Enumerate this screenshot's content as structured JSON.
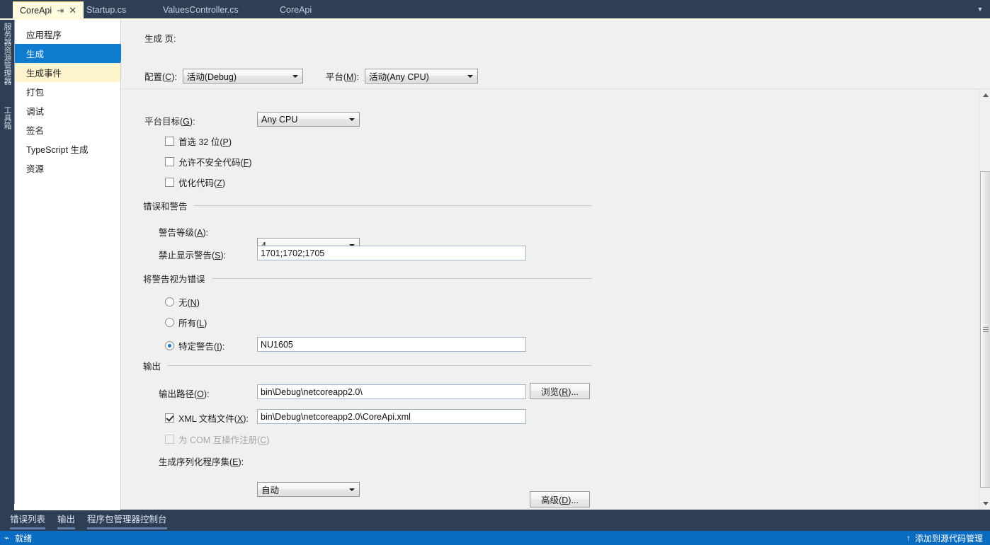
{
  "tabs": [
    {
      "label": "CoreApi",
      "active": true,
      "pin": "⇥",
      "close": "✕"
    },
    {
      "label": "Startup.cs",
      "active": false
    },
    {
      "label": "ValuesController.cs",
      "active": false
    },
    {
      "label": "CoreApi",
      "active": false
    }
  ],
  "vertical_docks": [
    {
      "label": "服务器资源管理器"
    },
    {
      "label": "工具箱"
    }
  ],
  "sidebar": {
    "items": [
      {
        "label": "应用程序",
        "state": "normal"
      },
      {
        "label": "生成",
        "state": "selected"
      },
      {
        "label": "生成事件",
        "state": "hovered"
      },
      {
        "label": "打包",
        "state": "normal"
      },
      {
        "label": "调试",
        "state": "normal"
      },
      {
        "label": "签名",
        "state": "normal"
      },
      {
        "label": "TypeScript 生成",
        "state": "normal"
      },
      {
        "label": "资源",
        "state": "normal"
      }
    ]
  },
  "page": {
    "title": "生成 页:",
    "configuration": {
      "label": "配置(C):",
      "label_prefix": "配置(",
      "label_key": "C",
      "label_suffix": "):",
      "value": "活动(Debug)"
    },
    "platform": {
      "label_prefix": "平台(",
      "label_key": "M",
      "label_suffix": "):",
      "value": "活动(Any CPU)"
    },
    "general": {
      "platform_target": {
        "label_prefix": "平台目标(",
        "label_key": "G",
        "label_suffix": "):",
        "value": "Any CPU"
      },
      "checkboxes": [
        {
          "prefix": "首选 32 位(",
          "key": "P",
          "suffix": ")",
          "checked": false,
          "disabled": false
        },
        {
          "prefix": "允许不安全代码(",
          "key": "F",
          "suffix": ")",
          "checked": false,
          "disabled": false
        },
        {
          "prefix": "优化代码(",
          "key": "Z",
          "suffix": ")",
          "checked": false,
          "disabled": false
        }
      ]
    },
    "errors_warnings": {
      "group_label": "错误和警告",
      "warning_level": {
        "label_prefix": "警告等级(",
        "label_key": "A",
        "label_suffix": "):",
        "value": "4"
      },
      "suppress_warnings": {
        "label_prefix": "禁止显示警告(",
        "label_key": "S",
        "label_suffix": "):",
        "value": "1701;1702;1705"
      }
    },
    "treat_warnings": {
      "group_label": "将警告视为错误",
      "options": [
        {
          "prefix": "无(",
          "key": "N",
          "suffix": ")",
          "selected": false
        },
        {
          "prefix": "所有(",
          "key": "L",
          "suffix": ")",
          "selected": false
        },
        {
          "prefix": "特定警告(",
          "key": "I",
          "suffix": "):",
          "selected": true
        }
      ],
      "specific_warnings_value": "NU1605"
    },
    "output": {
      "group_label": "输出",
      "output_path": {
        "label_prefix": "输出路径(",
        "label_key": "O",
        "label_suffix": "):",
        "value": "bin\\Debug\\netcoreapp2.0\\"
      },
      "browse_button": {
        "prefix": "浏览(",
        "key": "R",
        "suffix": ")..."
      },
      "xml_doc": {
        "prefix": "XML 文档文件(",
        "key": "X",
        "suffix": "):",
        "checked": true,
        "value": "bin\\Debug\\netcoreapp2.0\\CoreApi.xml"
      },
      "com_interop": {
        "prefix": "为 COM 互操作注册(",
        "key": "C",
        "suffix": ")",
        "checked": false,
        "disabled": true
      },
      "serialization": {
        "label_prefix": "生成序列化程序集(",
        "label_key": "E",
        "label_suffix": "):",
        "value": "自动"
      }
    },
    "advanced_button": {
      "prefix": "高级(",
      "key": "D",
      "suffix": ")..."
    }
  },
  "bottom_dock": {
    "tabs": [
      {
        "label": "错误列表",
        "active": true
      },
      {
        "label": "输出",
        "active": true
      },
      {
        "label": "程序包管理器控制台",
        "active": true
      }
    ]
  },
  "statusbar": {
    "left_icon": "⌁",
    "left_text": "就绪",
    "right_icon": "↑",
    "right_text": "添加到源代码管理"
  },
  "colors": {
    "accent_blue": "#0f7ccf",
    "status_blue": "#0a6cc0",
    "chrome_dark": "#2d3e55",
    "tab_active": "#fffcdf",
    "sidebar_hover": "#fdf4ce"
  }
}
